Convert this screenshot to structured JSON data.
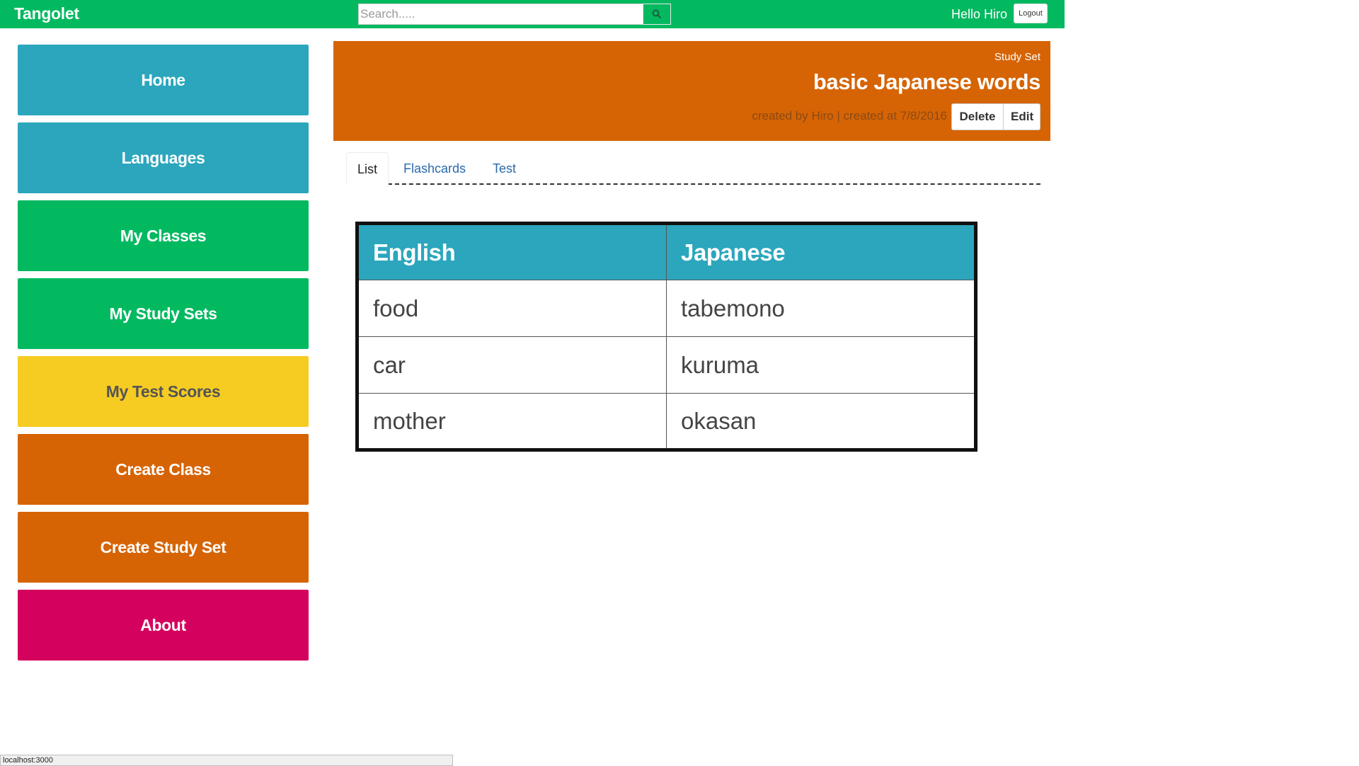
{
  "app": {
    "brand": "Tangolet"
  },
  "search": {
    "placeholder": "Search....."
  },
  "user": {
    "greeting": "Hello Hiro",
    "logout_label": "Logout"
  },
  "sidebar": {
    "items": [
      {
        "label": "Home",
        "color": "#2ba6bd"
      },
      {
        "label": "Languages",
        "color": "#2ba6bd"
      },
      {
        "label": "My Classes",
        "color": "#02b960"
      },
      {
        "label": "My Study Sets",
        "color": "#02b960"
      },
      {
        "label": "My Test Scores",
        "color": "#f6cc22"
      },
      {
        "label": "Create Class",
        "color": "#d66404"
      },
      {
        "label": "Create Study Set",
        "color": "#d66404"
      },
      {
        "label": "About",
        "color": "#d5015e"
      }
    ]
  },
  "study_set": {
    "label": "Study Set",
    "title": "basic Japanese words",
    "meta": "created by Hiro | created at 7/8/2016",
    "delete_label": "Delete",
    "edit_label": "Edit"
  },
  "tabs": [
    {
      "label": "List",
      "active": true
    },
    {
      "label": "Flashcards",
      "active": false
    },
    {
      "label": "Test",
      "active": false
    }
  ],
  "table": {
    "headers": [
      "English",
      "Japanese"
    ],
    "rows": [
      [
        "food",
        "tabemono"
      ],
      [
        "car",
        "kuruma"
      ],
      [
        "mother",
        "okasan"
      ]
    ]
  },
  "status_bar": {
    "url": "localhost:3000"
  },
  "colors": {
    "topbar": "#02b960",
    "teal": "#2ba6bd",
    "green": "#02b960",
    "yellow": "#f6cc22",
    "orange": "#d66404",
    "pink": "#d5015e"
  },
  "icons": {
    "search": "search-icon"
  }
}
